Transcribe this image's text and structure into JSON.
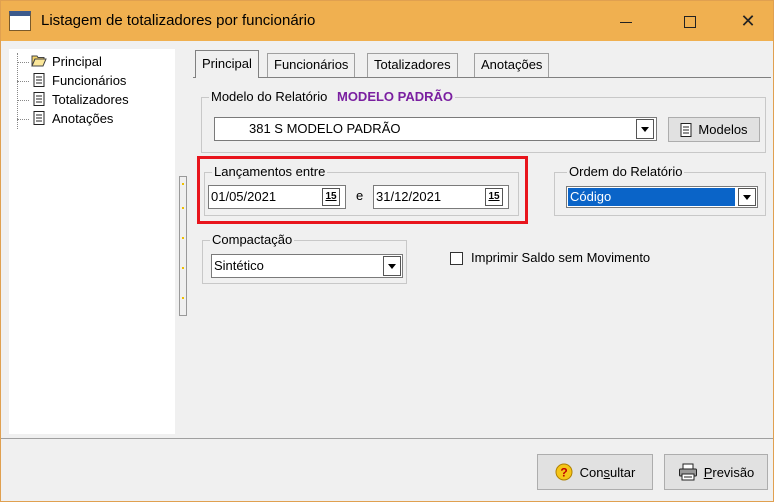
{
  "window": {
    "title": "Listagem de totalizadores por funcionário",
    "controls": {
      "minimize": "minimize",
      "maximize": "maximize",
      "close": "✕"
    }
  },
  "tree": {
    "items": [
      {
        "label": "Principal",
        "icon": "folder-open-icon"
      },
      {
        "label": "Funcionários",
        "icon": "document-icon"
      },
      {
        "label": "Totalizadores",
        "icon": "document-icon"
      },
      {
        "label": "Anotações",
        "icon": "document-icon"
      }
    ]
  },
  "tabs": [
    {
      "label": "Principal",
      "active": true
    },
    {
      "label": "Funcionários",
      "active": false
    },
    {
      "label": "Totalizadores",
      "active": false
    },
    {
      "label": "Anotações",
      "active": false
    }
  ],
  "modelo": {
    "legend": "Modelo do Relatório",
    "legend_value": "MODELO PADRÃO",
    "selected": "381 S  MODELO PADRÃO",
    "button_label": "Modelos"
  },
  "lancamentos": {
    "legend": "Lançamentos entre",
    "from": "01/05/2021",
    "between": "e",
    "to": "31/12/2021",
    "calendar_label": "15"
  },
  "ordem": {
    "legend": "Ordem do Relatório",
    "selected": "Código"
  },
  "compactacao": {
    "legend": "Compactação",
    "selected": "Sintético"
  },
  "imprimir_saldo": {
    "label": "Imprimir Saldo sem Movimento",
    "checked": false
  },
  "footer": {
    "consultar": {
      "pre": "Con",
      "underline": "s",
      "post": "ultar"
    },
    "previsao": {
      "pre": "",
      "underline": "P",
      "post": "revisão"
    }
  },
  "colors": {
    "titlebar": "#f0b050",
    "highlight": "#e8141c",
    "legend_accent": "#7a1fa0",
    "selection": "#0a64c8"
  }
}
